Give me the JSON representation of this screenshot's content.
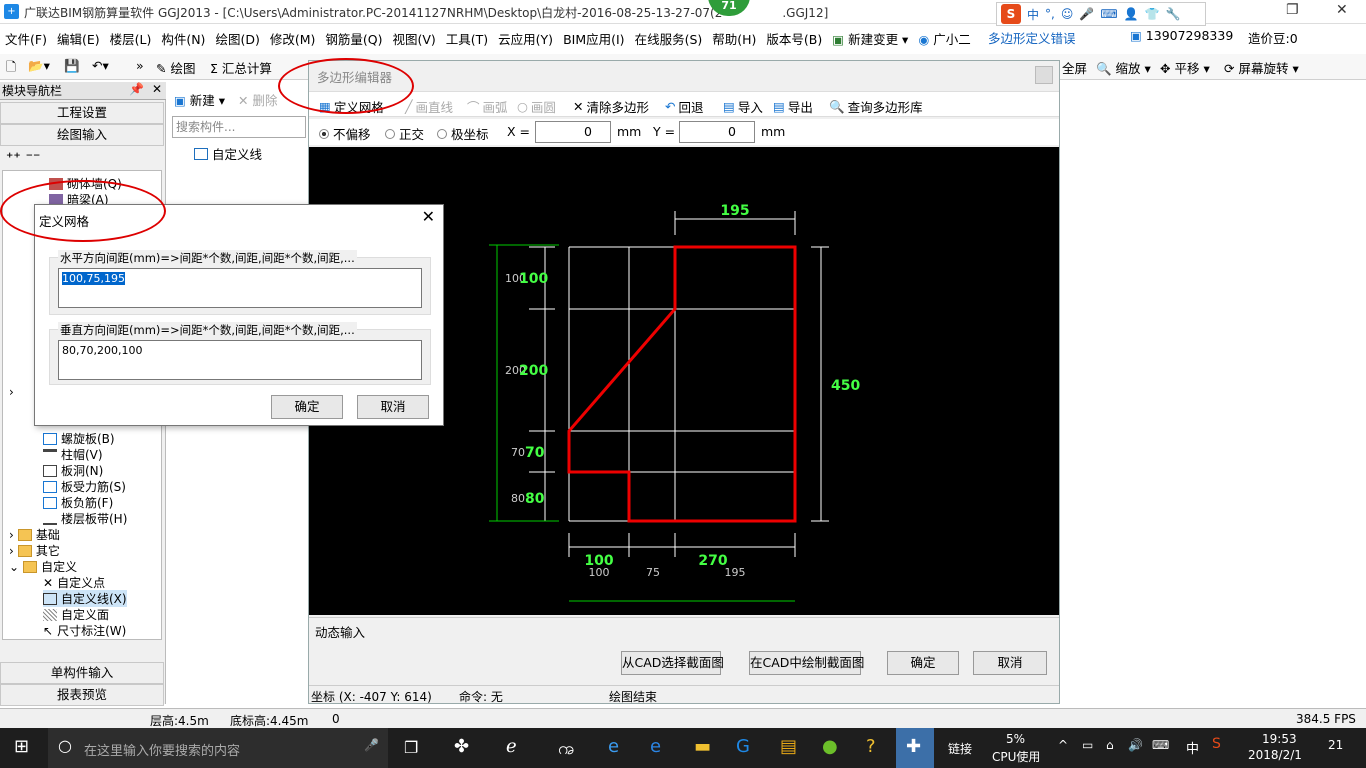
{
  "window": {
    "title": "广联达BIM钢筋算量软件 GGJ2013 - [C:\\Users\\Administrator.PC-20141127NRHM\\Desktop\\白龙村-2016-08-25-13-27-07(2",
    "title_suffix": ".GGJ12]",
    "badge": "71"
  },
  "ime": {
    "logo": "S",
    "mode": "中",
    "punct": "°,"
  },
  "menu": {
    "items": [
      "文件(F)",
      "编辑(E)",
      "楼层(L)",
      "构件(N)",
      "绘图(D)",
      "修改(M)",
      "钢筋量(Q)",
      "视图(V)",
      "工具(T)",
      "云应用(Y)",
      "BIM应用(I)",
      "在线服务(S)",
      "帮助(H)",
      "版本号(B)",
      "新建变更",
      "广小二"
    ],
    "polygon_error": "多边形定义错误",
    "phone": "13907298339",
    "beans": "造价豆:0"
  },
  "toolbar": {
    "draw": "绘图",
    "sum": "汇总计算",
    "fullscreen": "全屏",
    "zoom": "缩放",
    "pan": "平移",
    "rotate": "屏幕旋转"
  },
  "nav": {
    "header": "模块导航栏",
    "project_settings": "工程设置",
    "drawing_input": "绘图输入",
    "single_input": "单构件输入",
    "report": "报表预览",
    "tree": {
      "masonry": "砌体墙(Q)",
      "hidden_beam": "暗梁(A)",
      "spiral_slab": "螺旋板(B)",
      "column_cap": "柱帽(V)",
      "slab_hole": "板洞(N)",
      "slab_rebar": "板受力筋(S)",
      "slab_neg": "板负筋(F)",
      "floor_band": "楼层板带(H)",
      "foundation": "基础",
      "other": "其它",
      "custom": "自定义",
      "custom_point": "自定义点",
      "custom_line": "自定义线(X)",
      "custom_face": "自定义面",
      "dimension": "尺寸标注(W)"
    }
  },
  "components": {
    "new": "新建",
    "delete": "删除",
    "search_placeholder": "搜索构件...",
    "item": "自定义线"
  },
  "editor": {
    "title": "多边形编辑器",
    "tools": {
      "define_grid": "定义网格",
      "line": "画直线",
      "arc": "画弧",
      "circle": "画圆",
      "clear": "清除多边形",
      "undo": "回退",
      "import": "导入",
      "export": "导出",
      "query": "查询多边形库"
    },
    "coords": {
      "no_offset": "不偏移",
      "ortho": "正交",
      "polar": "极坐标",
      "x_label": "X =",
      "x_value": "0",
      "y_label": "Y =",
      "y_value": "0",
      "unit": "mm"
    },
    "dynamic_input": "动态输入",
    "btn_from_cad": "从CAD选择截面图",
    "btn_draw_cad": "在CAD中绘制截面图",
    "btn_ok": "确定",
    "btn_cancel": "取消",
    "status_coord": "坐标 (X: -407 Y: 614)",
    "status_cmd": "命令: 无",
    "status_end": "绘图结束"
  },
  "canvas": {
    "top_dim": "195",
    "right_dim": "450",
    "left_dims": [
      {
        "small": "100",
        "big": "100"
      },
      {
        "small": "200",
        "big": "200"
      },
      {
        "small": "70",
        "big": "70"
      },
      {
        "small": "80",
        "big": "80"
      }
    ],
    "bottom_big": [
      "100",
      "270"
    ],
    "bottom_small": [
      "100",
      "75",
      "195"
    ]
  },
  "grid_dialog": {
    "title": "定义网格",
    "h_label": "水平方向间距(mm)=>间距*个数,间距,间距*个数,间距,...",
    "h_value": "100,75,195",
    "v_label": "垂直方向间距(mm)=>间距*个数,间距,间距*个数,间距,...",
    "v_value": "80,70,200,100",
    "ok": "确定",
    "cancel": "取消"
  },
  "status": {
    "floor_height": "层高:4.5m",
    "base_height": "底标高:4.45m",
    "zero": "0",
    "fps": "384.5 FPS"
  },
  "taskbar": {
    "search": "在这里输入你要搜索的内容",
    "link": "链接",
    "cpu_pct": "5%",
    "cpu_label": "CPU使用",
    "lang": "中",
    "time": "19:53",
    "date": "2018/2/1",
    "notif": "21"
  }
}
